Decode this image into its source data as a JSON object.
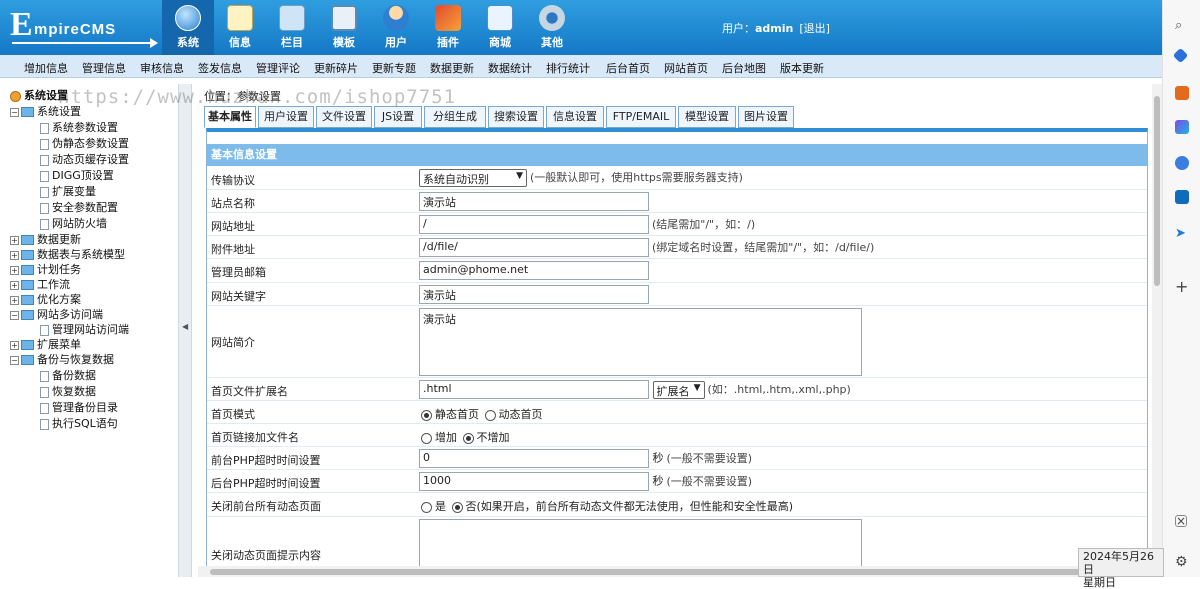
{
  "app": {
    "logo_e": "E",
    "logo_rest": "mpireCMS"
  },
  "topnav": [
    {
      "label": "系统",
      "icon": "globe-icon",
      "active": true
    },
    {
      "label": "信息",
      "icon": "edit-icon"
    },
    {
      "label": "栏目",
      "icon": "folder-icon"
    },
    {
      "label": "模板",
      "icon": "template-icon"
    },
    {
      "label": "用户",
      "icon": "user-icon"
    },
    {
      "label": "插件",
      "icon": "plugin-icon"
    },
    {
      "label": "商城",
      "icon": "shop-icon"
    },
    {
      "label": "其他",
      "icon": "gear-icon"
    }
  ],
  "user": {
    "prefix": "用户：",
    "name": "admin",
    "logout": "[退出]"
  },
  "subnav": [
    "增加信息",
    "管理信息",
    "审核信息",
    "签发信息",
    "管理评论",
    "更新碎片",
    "更新专题",
    "数据更新",
    "数据统计",
    "排行统计",
    "后台首页",
    "网站首页",
    "后台地图",
    "版本更新"
  ],
  "sidebar": {
    "root": "系统设置",
    "group1": "系统设置",
    "group1_items": [
      "系统参数设置",
      "伪静态参数设置",
      "动态页缓存设置",
      "DIGG顶设置",
      "扩展变量",
      "安全参数配置",
      "网站防火墙"
    ],
    "groups": [
      "数据更新",
      "数据表与系统模型",
      "计划任务",
      "工作流",
      "优化方案"
    ],
    "multi": "网站多访问端",
    "multi_items": [
      "管理网站访问端"
    ],
    "ext": "扩展菜单",
    "backup": "备份与恢复数据",
    "backup_items": [
      "备份数据",
      "恢复数据",
      "管理备份目录",
      "执行SQL语句"
    ]
  },
  "watermark": "https://www.huzhan.com/ishop7751",
  "breadcrumb": "位置：参数设置",
  "tabs": [
    "基本属性",
    "用户设置",
    "文件设置",
    "JS设置",
    "分组生成",
    "搜索设置",
    "信息设置",
    "FTP/EMAIL",
    "模型设置",
    "图片设置"
  ],
  "section_title": "基本信息设置",
  "form": {
    "protocol": {
      "label": "传输协议",
      "selected": "系统自动识别",
      "note": "(一般默认即可，使用https需要服务器支持)"
    },
    "site_name": {
      "label": "站点名称",
      "value": "演示站"
    },
    "site_url": {
      "label": "网站地址",
      "value": "/",
      "note": "(结尾需加\"/\"，如：/)"
    },
    "attach_url": {
      "label": "附件地址",
      "value": "/d/file/",
      "note": "(绑定域名时设置，结尾需加\"/\"，如：/d/file/)"
    },
    "admin_email": {
      "label": "管理员邮箱",
      "value": "admin@phome.net"
    },
    "keywords": {
      "label": "网站关键字",
      "value": "演示站"
    },
    "intro": {
      "label": "网站简介",
      "value": "演示站"
    },
    "index_ext": {
      "label": "首页文件扩展名",
      "value": ".html",
      "select": "扩展名",
      "note": "(如：.html,.htm,.xml,.php)"
    },
    "index_mode": {
      "label": "首页模式",
      "opt1": "静态首页",
      "opt2": "动态首页"
    },
    "index_link": {
      "label": "首页链接加文件名",
      "opt1": "增加",
      "opt2": "不增加"
    },
    "front_timeout": {
      "label": "前台PHP超时时间设置",
      "value": "0",
      "unit": "秒",
      "note": "(一般不需要设置)"
    },
    "back_timeout": {
      "label": "后台PHP超时时间设置",
      "value": "1000",
      "unit": "秒",
      "note": "(一般不需要设置)"
    },
    "close_dynamic": {
      "label": "关闭前台所有动态页面",
      "opt1": "是",
      "opt2": "否",
      "note": "(如果开启，前台所有动态文件都无法使用，但性能和安全性最高)"
    },
    "close_tip": {
      "label": "关闭动态页面提示内容",
      "value": ""
    }
  },
  "clock": {
    "date": "2024年5月26日",
    "weekday": "星期日"
  }
}
